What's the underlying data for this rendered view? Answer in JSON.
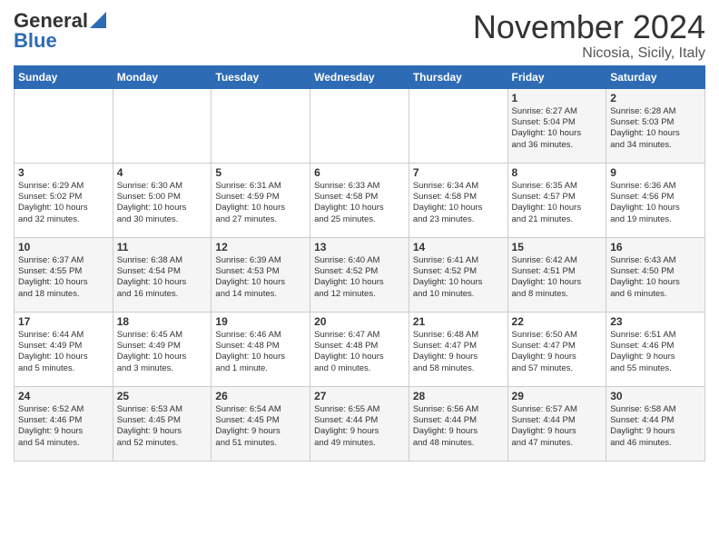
{
  "logo": {
    "general": "General",
    "blue": "Blue"
  },
  "title": "November 2024",
  "location": "Nicosia, Sicily, Italy",
  "days_of_week": [
    "Sunday",
    "Monday",
    "Tuesday",
    "Wednesday",
    "Thursday",
    "Friday",
    "Saturday"
  ],
  "weeks": [
    [
      {
        "day": "",
        "info": ""
      },
      {
        "day": "",
        "info": ""
      },
      {
        "day": "",
        "info": ""
      },
      {
        "day": "",
        "info": ""
      },
      {
        "day": "",
        "info": ""
      },
      {
        "day": "1",
        "info": "Sunrise: 6:27 AM\nSunset: 5:04 PM\nDaylight: 10 hours\nand 36 minutes."
      },
      {
        "day": "2",
        "info": "Sunrise: 6:28 AM\nSunset: 5:03 PM\nDaylight: 10 hours\nand 34 minutes."
      }
    ],
    [
      {
        "day": "3",
        "info": "Sunrise: 6:29 AM\nSunset: 5:02 PM\nDaylight: 10 hours\nand 32 minutes."
      },
      {
        "day": "4",
        "info": "Sunrise: 6:30 AM\nSunset: 5:00 PM\nDaylight: 10 hours\nand 30 minutes."
      },
      {
        "day": "5",
        "info": "Sunrise: 6:31 AM\nSunset: 4:59 PM\nDaylight: 10 hours\nand 27 minutes."
      },
      {
        "day": "6",
        "info": "Sunrise: 6:33 AM\nSunset: 4:58 PM\nDaylight: 10 hours\nand 25 minutes."
      },
      {
        "day": "7",
        "info": "Sunrise: 6:34 AM\nSunset: 4:58 PM\nDaylight: 10 hours\nand 23 minutes."
      },
      {
        "day": "8",
        "info": "Sunrise: 6:35 AM\nSunset: 4:57 PM\nDaylight: 10 hours\nand 21 minutes."
      },
      {
        "day": "9",
        "info": "Sunrise: 6:36 AM\nSunset: 4:56 PM\nDaylight: 10 hours\nand 19 minutes."
      }
    ],
    [
      {
        "day": "10",
        "info": "Sunrise: 6:37 AM\nSunset: 4:55 PM\nDaylight: 10 hours\nand 18 minutes."
      },
      {
        "day": "11",
        "info": "Sunrise: 6:38 AM\nSunset: 4:54 PM\nDaylight: 10 hours\nand 16 minutes."
      },
      {
        "day": "12",
        "info": "Sunrise: 6:39 AM\nSunset: 4:53 PM\nDaylight: 10 hours\nand 14 minutes."
      },
      {
        "day": "13",
        "info": "Sunrise: 6:40 AM\nSunset: 4:52 PM\nDaylight: 10 hours\nand 12 minutes."
      },
      {
        "day": "14",
        "info": "Sunrise: 6:41 AM\nSunset: 4:52 PM\nDaylight: 10 hours\nand 10 minutes."
      },
      {
        "day": "15",
        "info": "Sunrise: 6:42 AM\nSunset: 4:51 PM\nDaylight: 10 hours\nand 8 minutes."
      },
      {
        "day": "16",
        "info": "Sunrise: 6:43 AM\nSunset: 4:50 PM\nDaylight: 10 hours\nand 6 minutes."
      }
    ],
    [
      {
        "day": "17",
        "info": "Sunrise: 6:44 AM\nSunset: 4:49 PM\nDaylight: 10 hours\nand 5 minutes."
      },
      {
        "day": "18",
        "info": "Sunrise: 6:45 AM\nSunset: 4:49 PM\nDaylight: 10 hours\nand 3 minutes."
      },
      {
        "day": "19",
        "info": "Sunrise: 6:46 AM\nSunset: 4:48 PM\nDaylight: 10 hours\nand 1 minute."
      },
      {
        "day": "20",
        "info": "Sunrise: 6:47 AM\nSunset: 4:48 PM\nDaylight: 10 hours\nand 0 minutes."
      },
      {
        "day": "21",
        "info": "Sunrise: 6:48 AM\nSunset: 4:47 PM\nDaylight: 9 hours\nand 58 minutes."
      },
      {
        "day": "22",
        "info": "Sunrise: 6:50 AM\nSunset: 4:47 PM\nDaylight: 9 hours\nand 57 minutes."
      },
      {
        "day": "23",
        "info": "Sunrise: 6:51 AM\nSunset: 4:46 PM\nDaylight: 9 hours\nand 55 minutes."
      }
    ],
    [
      {
        "day": "24",
        "info": "Sunrise: 6:52 AM\nSunset: 4:46 PM\nDaylight: 9 hours\nand 54 minutes."
      },
      {
        "day": "25",
        "info": "Sunrise: 6:53 AM\nSunset: 4:45 PM\nDaylight: 9 hours\nand 52 minutes."
      },
      {
        "day": "26",
        "info": "Sunrise: 6:54 AM\nSunset: 4:45 PM\nDaylight: 9 hours\nand 51 minutes."
      },
      {
        "day": "27",
        "info": "Sunrise: 6:55 AM\nSunset: 4:44 PM\nDaylight: 9 hours\nand 49 minutes."
      },
      {
        "day": "28",
        "info": "Sunrise: 6:56 AM\nSunset: 4:44 PM\nDaylight: 9 hours\nand 48 minutes."
      },
      {
        "day": "29",
        "info": "Sunrise: 6:57 AM\nSunset: 4:44 PM\nDaylight: 9 hours\nand 47 minutes."
      },
      {
        "day": "30",
        "info": "Sunrise: 6:58 AM\nSunset: 4:44 PM\nDaylight: 9 hours\nand 46 minutes."
      }
    ]
  ]
}
